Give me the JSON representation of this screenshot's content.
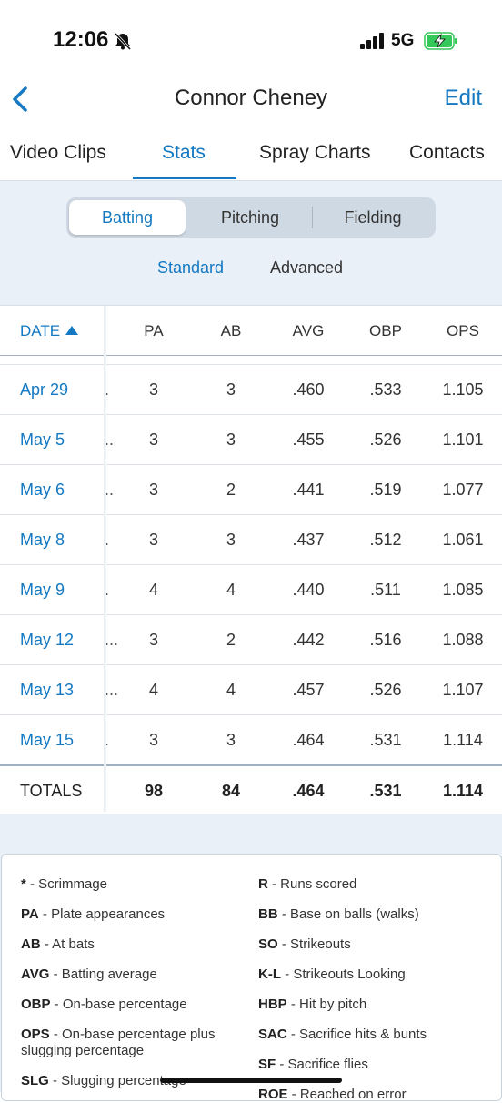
{
  "status_bar": {
    "time": "12:06",
    "network": "5G"
  },
  "nav": {
    "title": "Connor Cheney",
    "edit_label": "Edit"
  },
  "tabs": [
    "Video Clips",
    "Stats",
    "Spray Charts",
    "Contacts"
  ],
  "active_tab": "Stats",
  "segments": [
    "Batting",
    "Pitching",
    "Fielding"
  ],
  "selected_segment": "Batting",
  "subtabs": [
    "Standard",
    "Advanced"
  ],
  "selected_subtab": "Standard",
  "table": {
    "headers": [
      "DATE",
      "PA",
      "AB",
      "AVG",
      "OBP",
      "OPS"
    ],
    "rows": [
      {
        "date": "Apr 29",
        "dots": ".",
        "pa": "3",
        "ab": "3",
        "avg": ".460",
        "obp": ".533",
        "ops": "1.105"
      },
      {
        "date": "May 5",
        "dots": "..",
        "pa": "3",
        "ab": "3",
        "avg": ".455",
        "obp": ".526",
        "ops": "1.101"
      },
      {
        "date": "May 6",
        "dots": "..",
        "pa": "3",
        "ab": "2",
        "avg": ".441",
        "obp": ".519",
        "ops": "1.077"
      },
      {
        "date": "May 8",
        "dots": ".",
        "pa": "3",
        "ab": "3",
        "avg": ".437",
        "obp": ".512",
        "ops": "1.061"
      },
      {
        "date": "May 9",
        "dots": ".",
        "pa": "4",
        "ab": "4",
        "avg": ".440",
        "obp": ".511",
        "ops": "1.085"
      },
      {
        "date": "May 12",
        "dots": "...",
        "pa": "3",
        "ab": "2",
        "avg": ".442",
        "obp": ".516",
        "ops": "1.088"
      },
      {
        "date": "May 13",
        "dots": "...",
        "pa": "4",
        "ab": "4",
        "avg": ".457",
        "obp": ".526",
        "ops": "1.107"
      },
      {
        "date": "May 15",
        "dots": ".",
        "pa": "3",
        "ab": "3",
        "avg": ".464",
        "obp": ".531",
        "ops": "1.114"
      }
    ],
    "totals": {
      "label": "TOTALS",
      "pa": "98",
      "ab": "84",
      "avg": ".464",
      "obp": ".531",
      "ops": "1.114"
    }
  },
  "legend": {
    "left": [
      {
        "abbr": "*",
        "desc": " - Scrimmage"
      },
      {
        "abbr": "PA",
        "desc": " - Plate appearances"
      },
      {
        "abbr": "AB",
        "desc": " - At bats"
      },
      {
        "abbr": "AVG",
        "desc": " - Batting average"
      },
      {
        "abbr": "OBP",
        "desc": " - On-base percentage"
      },
      {
        "abbr": "OPS",
        "desc": " - On-base percentage plus slugging percentage"
      },
      {
        "abbr": "SLG",
        "desc": " - Slugging percentage"
      }
    ],
    "right": [
      {
        "abbr": "R",
        "desc": " - Runs scored"
      },
      {
        "abbr": "BB",
        "desc": " - Base on balls (walks)"
      },
      {
        "abbr": "SO",
        "desc": " - Strikeouts"
      },
      {
        "abbr": "K-L",
        "desc": " - Strikeouts Looking"
      },
      {
        "abbr": "HBP",
        "desc": " - Hit by pitch"
      },
      {
        "abbr": "SAC",
        "desc": " - Sacrifice hits & bunts"
      },
      {
        "abbr": "SF",
        "desc": " - Sacrifice flies"
      },
      {
        "abbr": "ROE",
        "desc": " - Reached on error"
      }
    ]
  },
  "colors": {
    "accent": "#1479c2",
    "filter_bg": "#eaf0f8",
    "battery": "#34c759"
  }
}
